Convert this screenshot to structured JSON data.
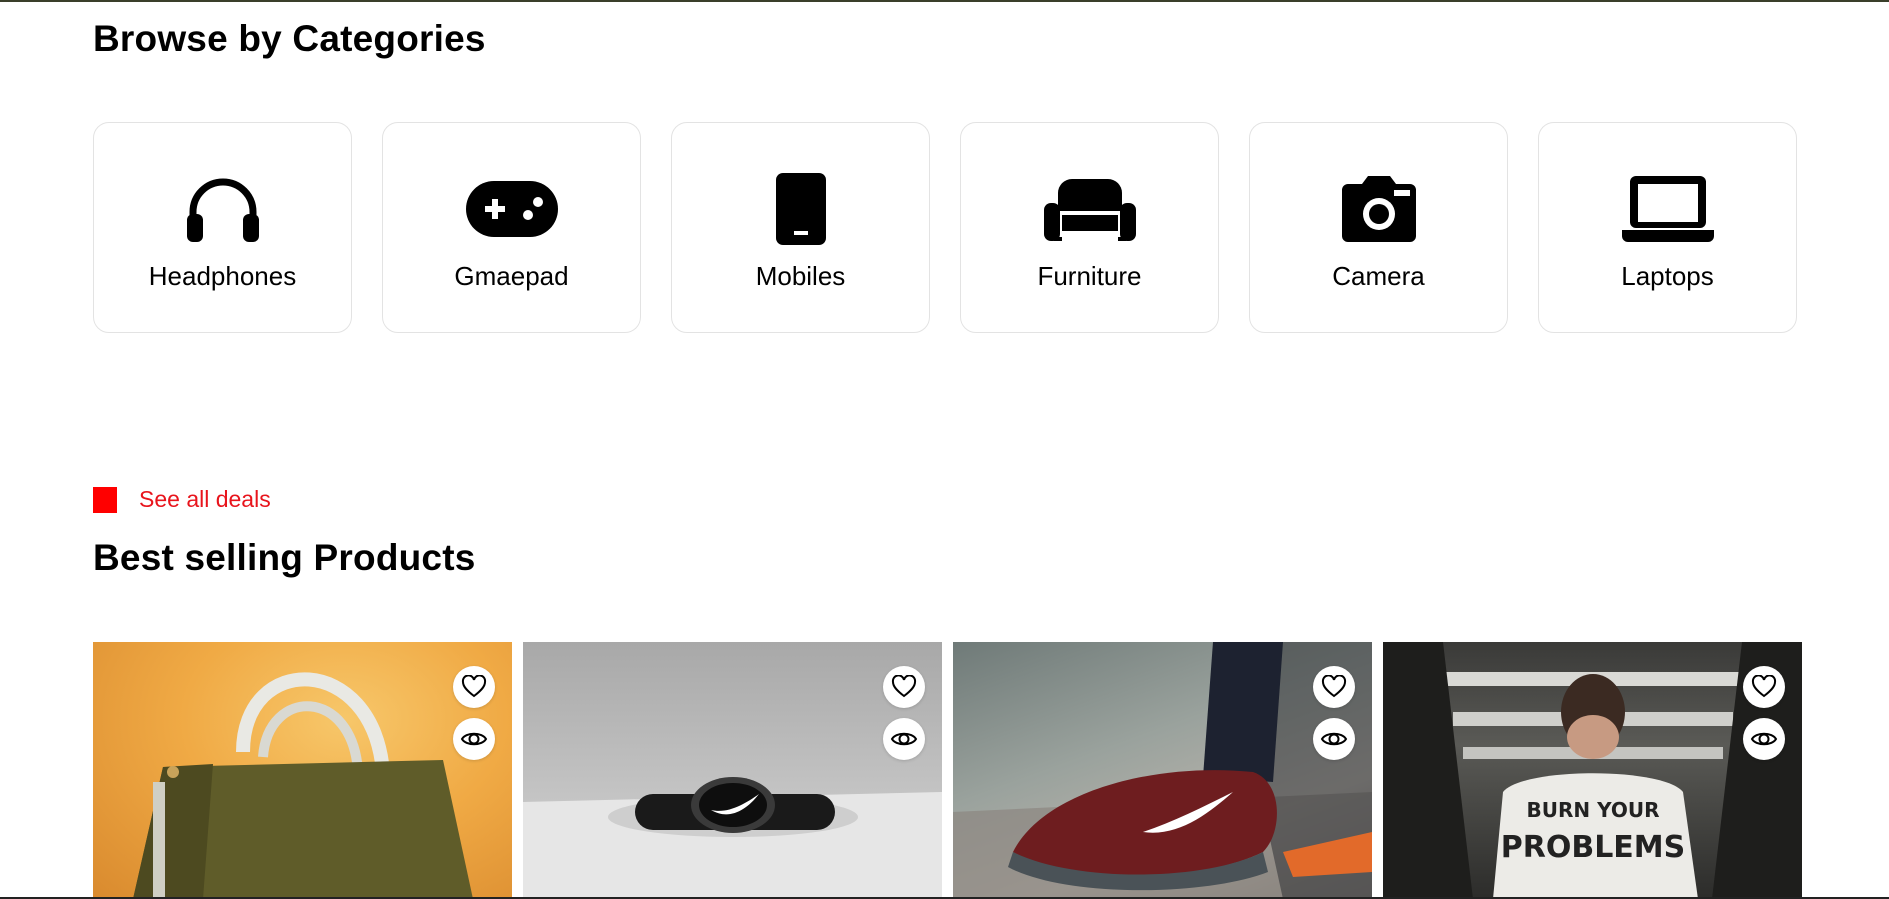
{
  "categories_section": {
    "title": "Browse by Categories",
    "items": [
      {
        "label": "Headphones",
        "icon": "headphones-icon"
      },
      {
        "label": "Gmaepad",
        "icon": "gamepad-icon"
      },
      {
        "label": "Mobiles",
        "icon": "mobile-phone-icon"
      },
      {
        "label": "Furniture",
        "icon": "sofa-icon"
      },
      {
        "label": "Camera",
        "icon": "camera-icon"
      },
      {
        "label": "Laptops",
        "icon": "laptop-icon"
      }
    ]
  },
  "deals_link": {
    "label": "See all deals",
    "accent_color": "#ff0000"
  },
  "products_section": {
    "title": "Best selling Products",
    "items": [
      {
        "image": "olive-green-tote-bag",
        "actions": [
          "heart-icon",
          "eye-icon"
        ]
      },
      {
        "image": "black-nike-watch",
        "actions": [
          "heart-icon",
          "eye-icon"
        ]
      },
      {
        "image": "red-nike-flyknit-sneaker",
        "actions": [
          "heart-icon",
          "eye-icon"
        ]
      },
      {
        "image": "man-in-white-graphic-t-shirt",
        "actions": [
          "heart-icon",
          "eye-icon"
        ]
      }
    ]
  }
}
